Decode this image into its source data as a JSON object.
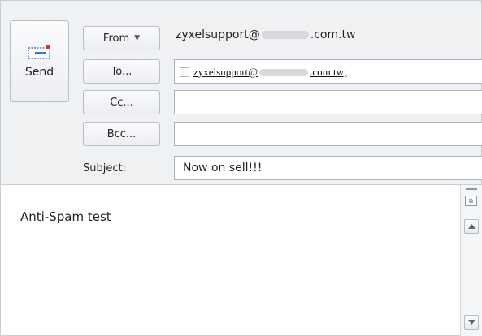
{
  "toolbar": {
    "send_label": "Send"
  },
  "header": {
    "from_label": "From",
    "from_address": {
      "prefix": "zyxelsupport@",
      "suffix": ".com.tw"
    },
    "to_label": "To...",
    "to_recipient": {
      "prefix": "zyxelsupport@",
      "suffix": ".com.tw;"
    },
    "cc_label": "Cc...",
    "cc_value": "",
    "bcc_label": "Bcc...",
    "bcc_value": "",
    "subject_label": "Subject:",
    "subject_value": "Now on sell!!!"
  },
  "body": {
    "text": "Anti-Spam test"
  },
  "icons": {
    "send": "send-mail-icon",
    "from_dropdown": "chevron-down-icon",
    "recipient_check": "checkbox-icon",
    "scroll_up": "arrow-up-icon",
    "scroll_down": "arrow-down-icon"
  },
  "colors": {
    "header_bg": "#f0f1f3",
    "send_icon_blue": "#3a78c8",
    "send_icon_red": "#e0312a"
  }
}
